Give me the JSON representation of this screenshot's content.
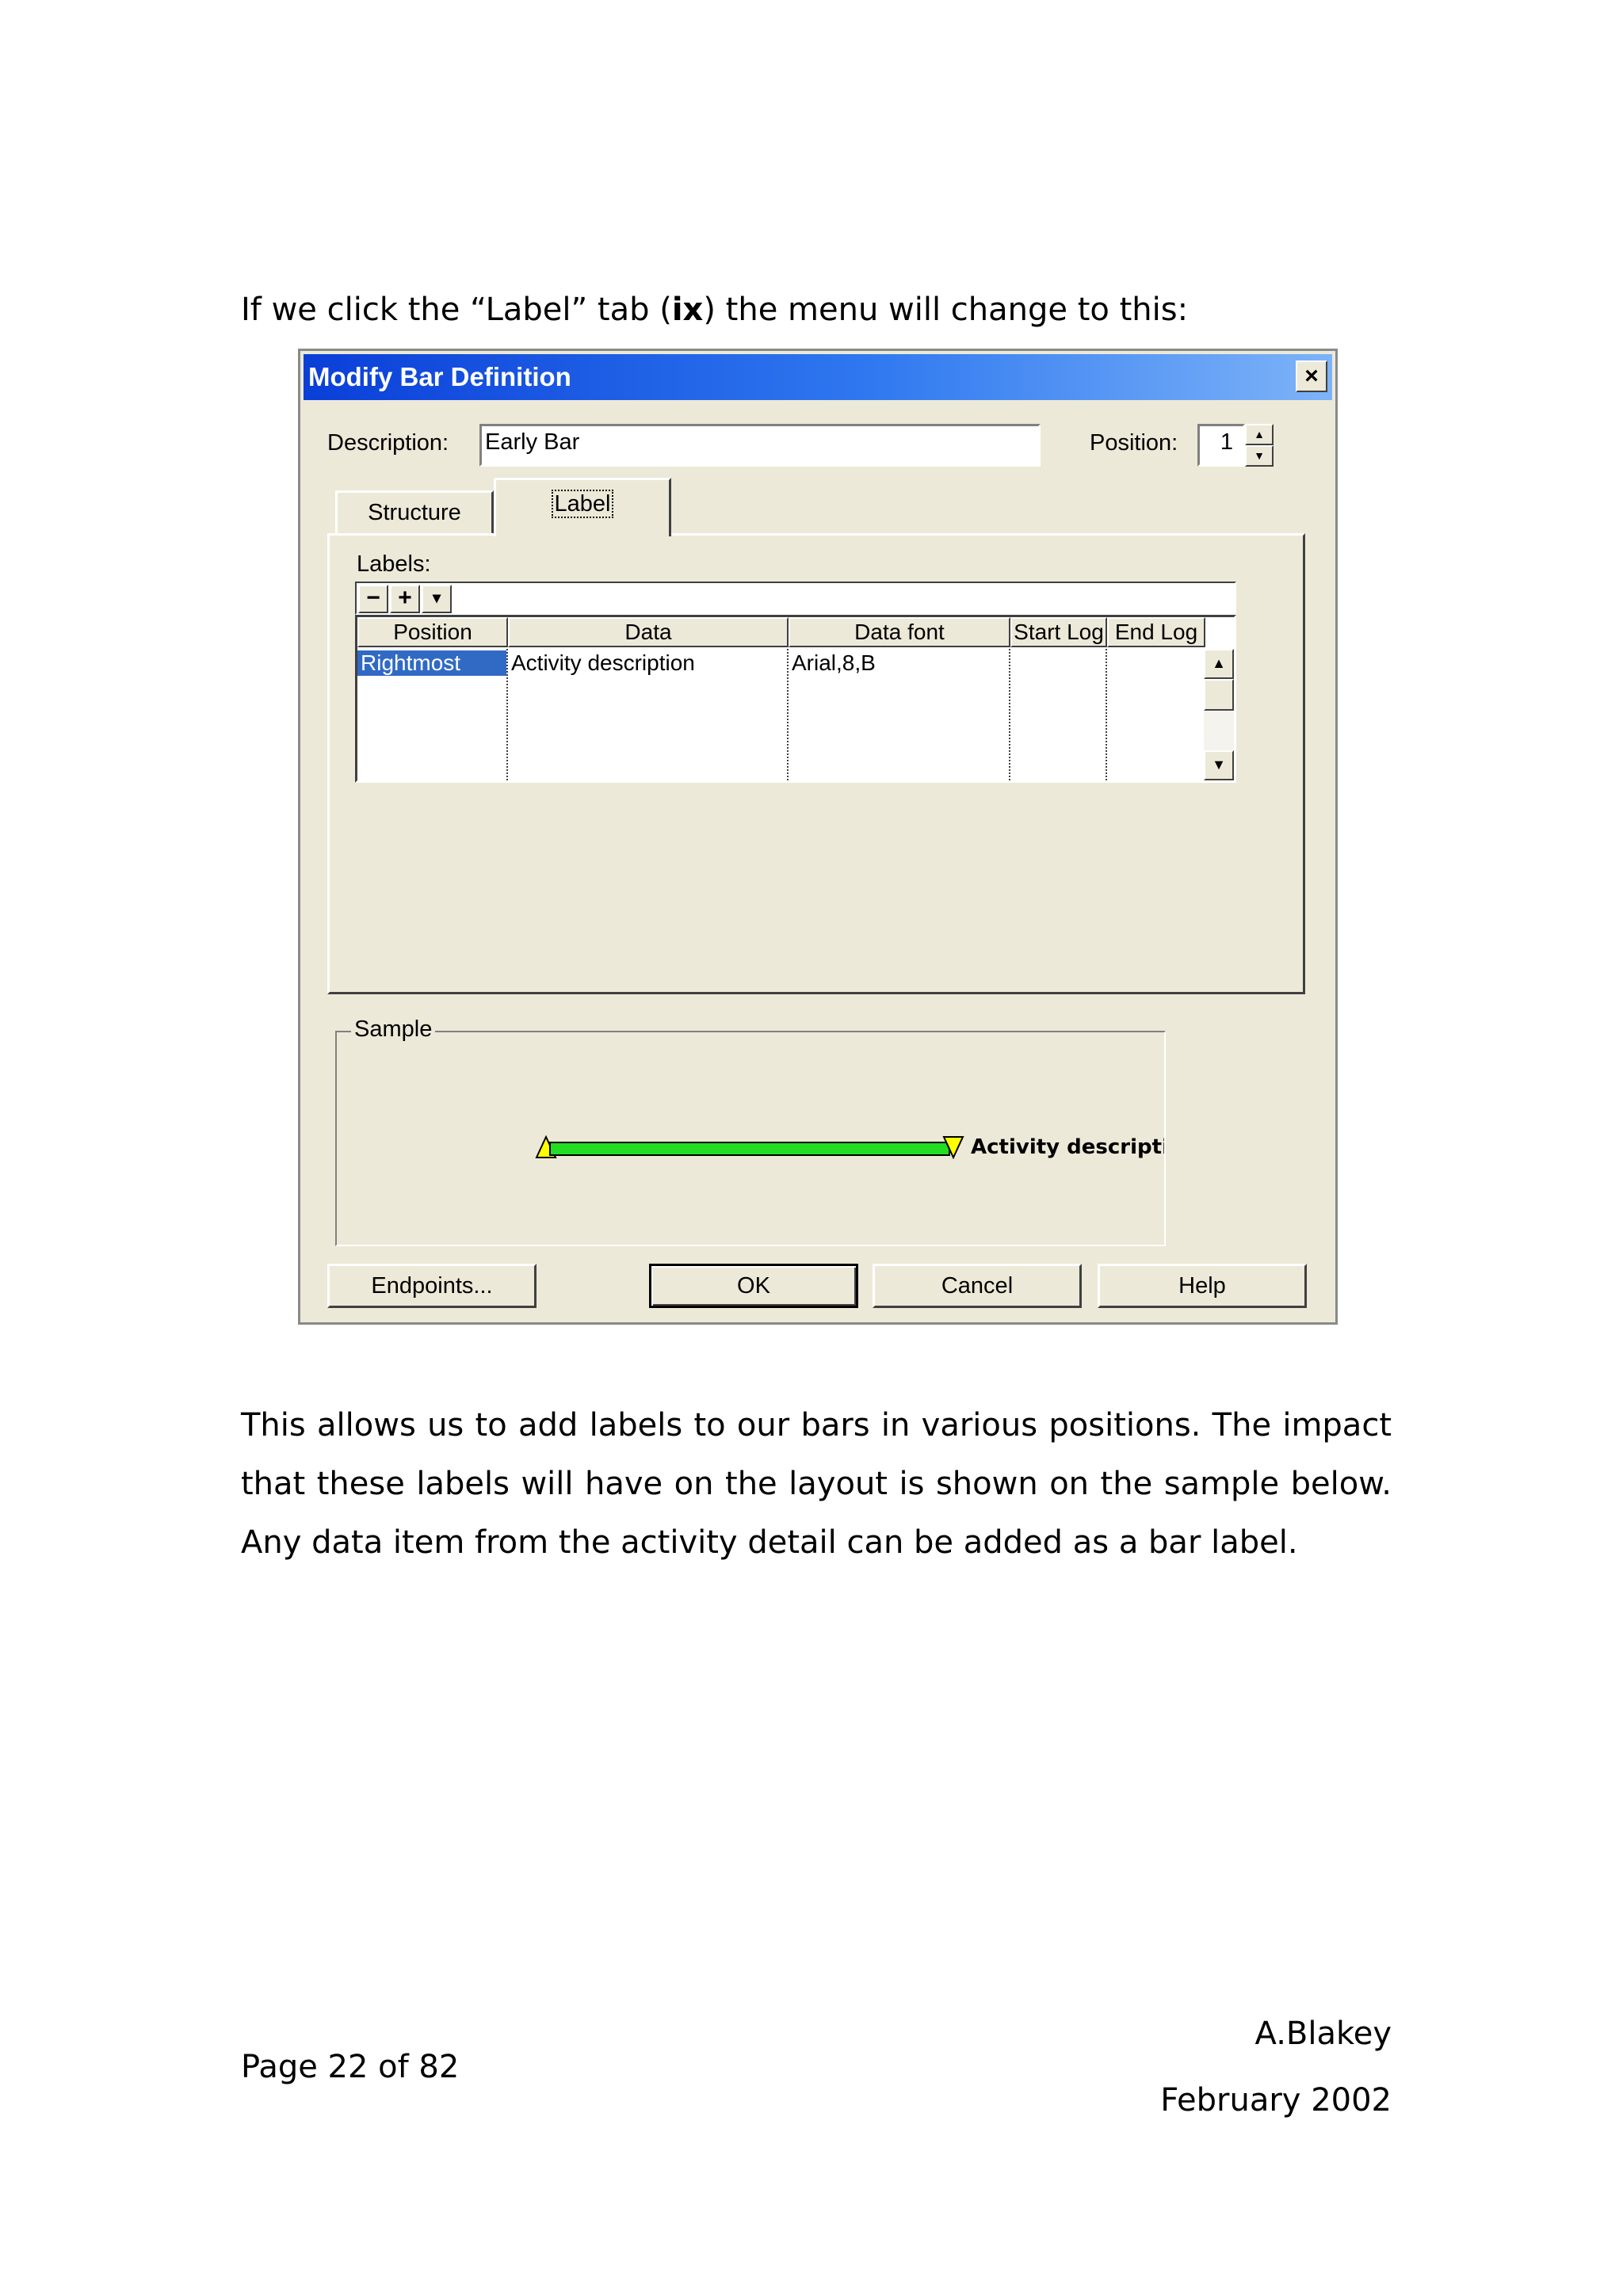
{
  "document": {
    "intro_before": "If we click the “Label” tab (",
    "intro_bold": "ix",
    "intro_after": ") the menu will change to this:",
    "body_paragraph": "This allows us to add labels to our bars in various positions. The impact that these labels will have on the layout is shown on the sample below. Any data item from the activity detail can be added as a bar label.",
    "page_number": "Page 22 of 82",
    "author": "A.Blakey",
    "date": "February 2002"
  },
  "dialog": {
    "title": "Modify Bar Definition",
    "close_glyph": "×",
    "description_label": "Description:",
    "description_value": "Early Bar",
    "position_label": "Position:",
    "position_value": "1",
    "tabs": [
      {
        "label": "Structure",
        "active": false
      },
      {
        "label": "Label",
        "active": true
      }
    ],
    "labels_caption": "Labels:",
    "toolbar": {
      "remove_glyph": "−",
      "add_glyph": "+",
      "menu_glyph": "▾"
    },
    "grid": {
      "columns": [
        "Position",
        "Data",
        "Data font",
        "Start Log",
        "End Log"
      ],
      "rows": [
        {
          "position": "Rightmost",
          "data": "Activity description",
          "data_font": "Arial,8,B",
          "start_log": "",
          "end_log": ""
        }
      ]
    },
    "sample": {
      "title": "Sample",
      "label_text": "Activity description",
      "bar_color": "#22dd22",
      "endpoint_color": "#ffff00"
    },
    "buttons": {
      "endpoints": "Endpoints...",
      "ok": "OK",
      "cancel": "Cancel",
      "help": "Help"
    },
    "colors": {
      "titlebar_start": "#0a3fd8",
      "titlebar_end": "#7db3f8",
      "face": "#ece9d8",
      "selection": "#316ac5"
    }
  }
}
